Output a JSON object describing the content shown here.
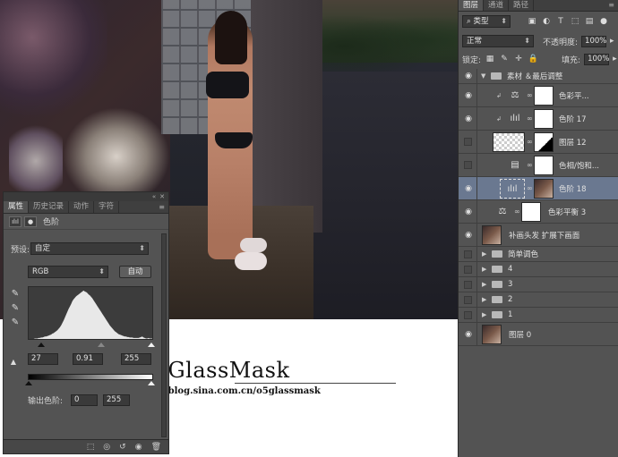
{
  "canvas": {
    "watermark_title": "GlassMask",
    "watermark_url": "http://blog.sina.com.cn/o5glassmask"
  },
  "properties": {
    "tabs": [
      "属性",
      "历史记录",
      "动作",
      "字符"
    ],
    "adjustment_name": "色阶",
    "preset_label": "预设:",
    "preset_value": "自定",
    "channel_value": "RGB",
    "auto_button": "自动",
    "input_black": "27",
    "input_gamma": "0.91",
    "input_white": "255",
    "output_label": "输出色阶:",
    "output_black": "0",
    "output_white": "255",
    "histogram_profile": [
      0,
      0,
      0,
      0,
      0,
      1,
      1,
      1,
      2,
      2,
      3,
      3,
      4,
      5,
      5,
      6,
      7,
      8,
      9,
      11,
      12,
      14,
      16,
      18,
      21,
      24,
      28,
      33,
      38,
      44,
      50,
      56,
      62,
      67,
      72,
      78,
      82,
      85,
      88,
      90,
      92,
      94,
      96,
      98,
      100,
      98,
      97,
      95,
      92,
      90,
      87,
      84,
      80,
      76,
      72,
      68,
      64,
      60,
      56,
      52,
      48,
      44,
      40,
      36,
      32,
      28,
      25,
      22,
      19,
      16,
      14,
      12,
      10,
      9,
      8,
      7,
      6,
      5,
      5,
      4,
      4,
      3,
      3,
      3,
      2,
      2,
      2,
      2,
      2,
      3,
      4,
      5,
      3,
      2,
      1,
      1,
      2,
      1,
      1,
      1
    ]
  },
  "layers": {
    "tabs": [
      "图层",
      "通道",
      "路径"
    ],
    "filter_kind": "类型",
    "blend_mode": "正常",
    "opacity_label": "不透明度:",
    "opacity_value": "100%",
    "lock_label": "锁定:",
    "fill_label": "填充:",
    "fill_value": "100%",
    "items": [
      {
        "name": "素材 ＆最后调整",
        "type": "group-open",
        "visible": true
      },
      {
        "name": "色彩平...",
        "type": "adjustment",
        "icon": "balance",
        "clipped": true,
        "visible": true
      },
      {
        "name": "色阶 17",
        "type": "adjustment",
        "icon": "levels",
        "clipped": true,
        "visible": true
      },
      {
        "name": "图层 12",
        "type": "pixel",
        "visible": false
      },
      {
        "name": "色相/饱和...",
        "type": "adjustment",
        "icon": "hue",
        "visible": false
      },
      {
        "name": "色阶 18",
        "type": "adjustment",
        "icon": "levels",
        "visible": true,
        "selected": true
      },
      {
        "name": "色彩平衡 3",
        "type": "adjustment",
        "icon": "balance",
        "visible": true
      },
      {
        "name": "补画头发 扩展下画面",
        "type": "photo",
        "visible": true
      },
      {
        "name": "简单调色",
        "type": "group",
        "visible": false
      },
      {
        "name": "4",
        "type": "group",
        "visible": false
      },
      {
        "name": "3",
        "type": "group",
        "visible": false
      },
      {
        "name": "2",
        "type": "group",
        "visible": false
      },
      {
        "name": "1",
        "type": "group",
        "visible": false
      },
      {
        "name": "图层 0",
        "type": "photo",
        "visible": true
      }
    ]
  }
}
